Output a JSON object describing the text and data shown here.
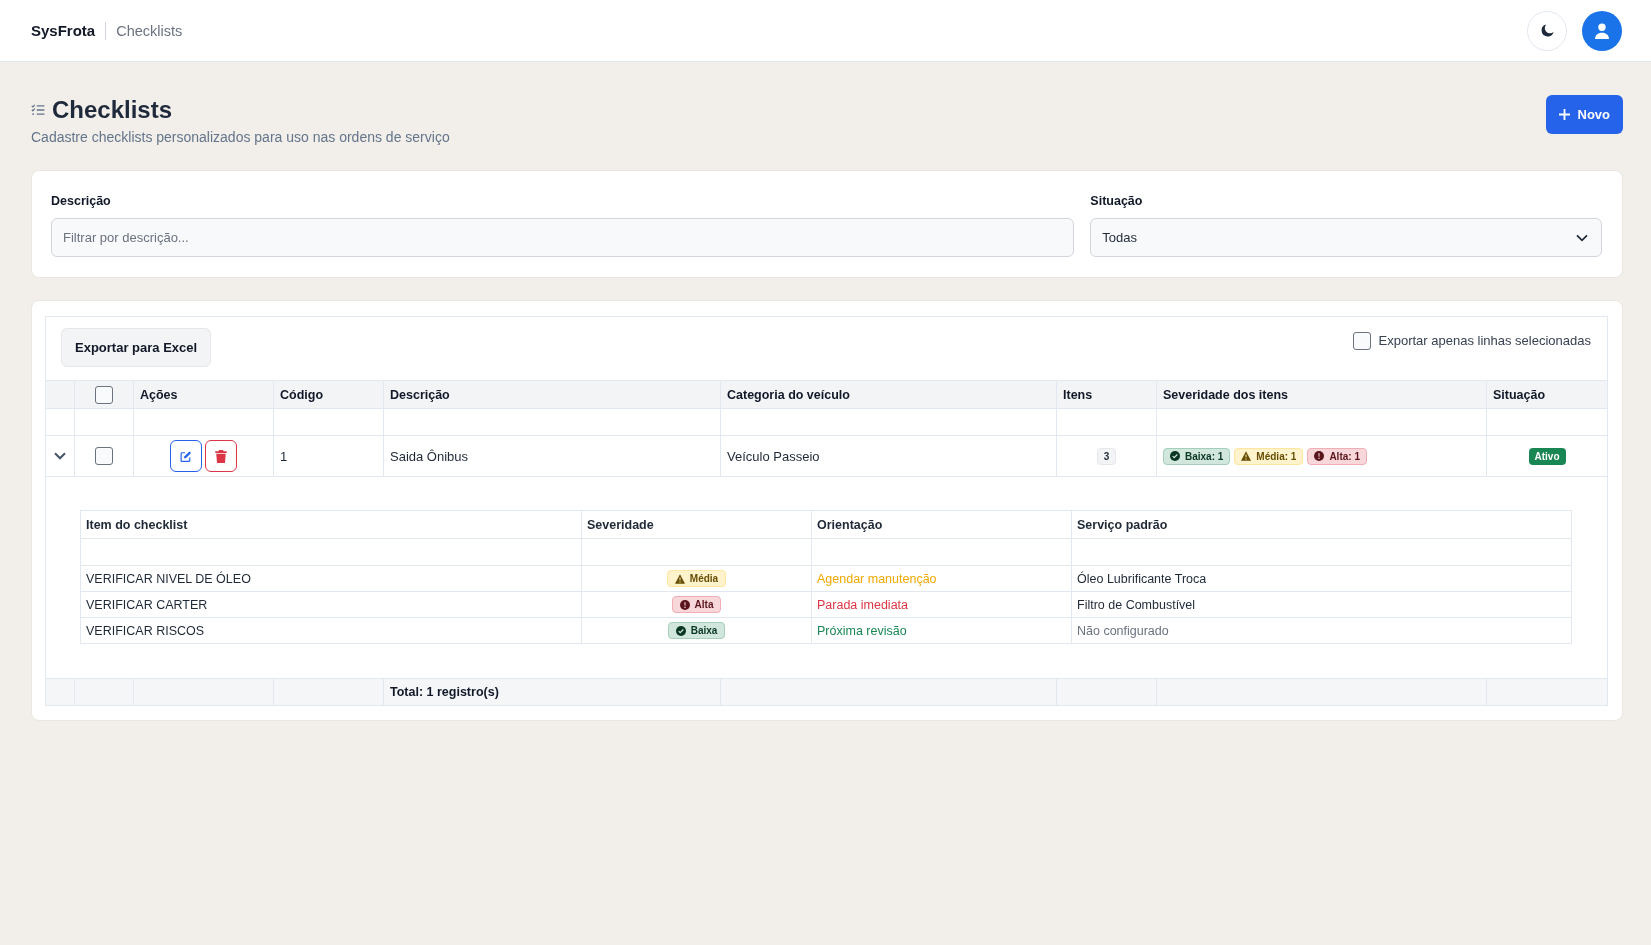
{
  "header": {
    "brand": "SysFrota",
    "breadcrumb": "Checklists"
  },
  "page": {
    "title": "Checklists",
    "subtitle": "Cadastre checklists personalizados para uso nas ordens de serviço",
    "new_button": "Novo"
  },
  "filters": {
    "description": {
      "label": "Descrição",
      "placeholder": "Filtrar por descrição..."
    },
    "status": {
      "label": "Situação",
      "value": "Todas"
    }
  },
  "grid": {
    "export_button": "Exportar para Excel",
    "export_selected_only": {
      "label": "Exportar apenas linhas selecionadas",
      "checked": false
    },
    "select_all_checked": false,
    "columns": [
      "Ações",
      "Código",
      "Descrição",
      "Categoria do veículo",
      "Itens",
      "Severidade dos itens",
      "Situação"
    ],
    "rows": [
      {
        "expanded": true,
        "checked": false,
        "code": "1",
        "description": "Saida Ônibus",
        "category": "Veículo Passeio",
        "items_count": "3",
        "severity_summary": [
          {
            "kind": "low",
            "label": "Baixa: 1"
          },
          {
            "kind": "medium",
            "label": "Média: 1"
          },
          {
            "kind": "high",
            "label": "Alta: 1"
          }
        ],
        "status": {
          "label": "Ativo",
          "active": true
        },
        "detail": {
          "columns": [
            "Item do checklist",
            "Severidade",
            "Orientação",
            "Serviço padrão"
          ],
          "items": [
            {
              "item": "VERIFICAR NIVEL DE ÓLEO",
              "severity": {
                "kind": "medium",
                "label": "Média"
              },
              "guidance": "Agendar manutenção",
              "default_service": "Óleo Lubrificante Troca",
              "service_configured": true
            },
            {
              "item": "VERIFICAR CARTER",
              "severity": {
                "kind": "high",
                "label": "Alta"
              },
              "guidance": "Parada imediata",
              "default_service": "Filtro de Combustível",
              "service_configured": true
            },
            {
              "item": "VERIFICAR RISCOS",
              "severity": {
                "kind": "low",
                "label": "Baixa"
              },
              "guidance": "Próxima revisão",
              "default_service": "Não configurado",
              "service_configured": false
            }
          ]
        }
      }
    ],
    "footer_total": "Total: 1 registro(s)"
  }
}
